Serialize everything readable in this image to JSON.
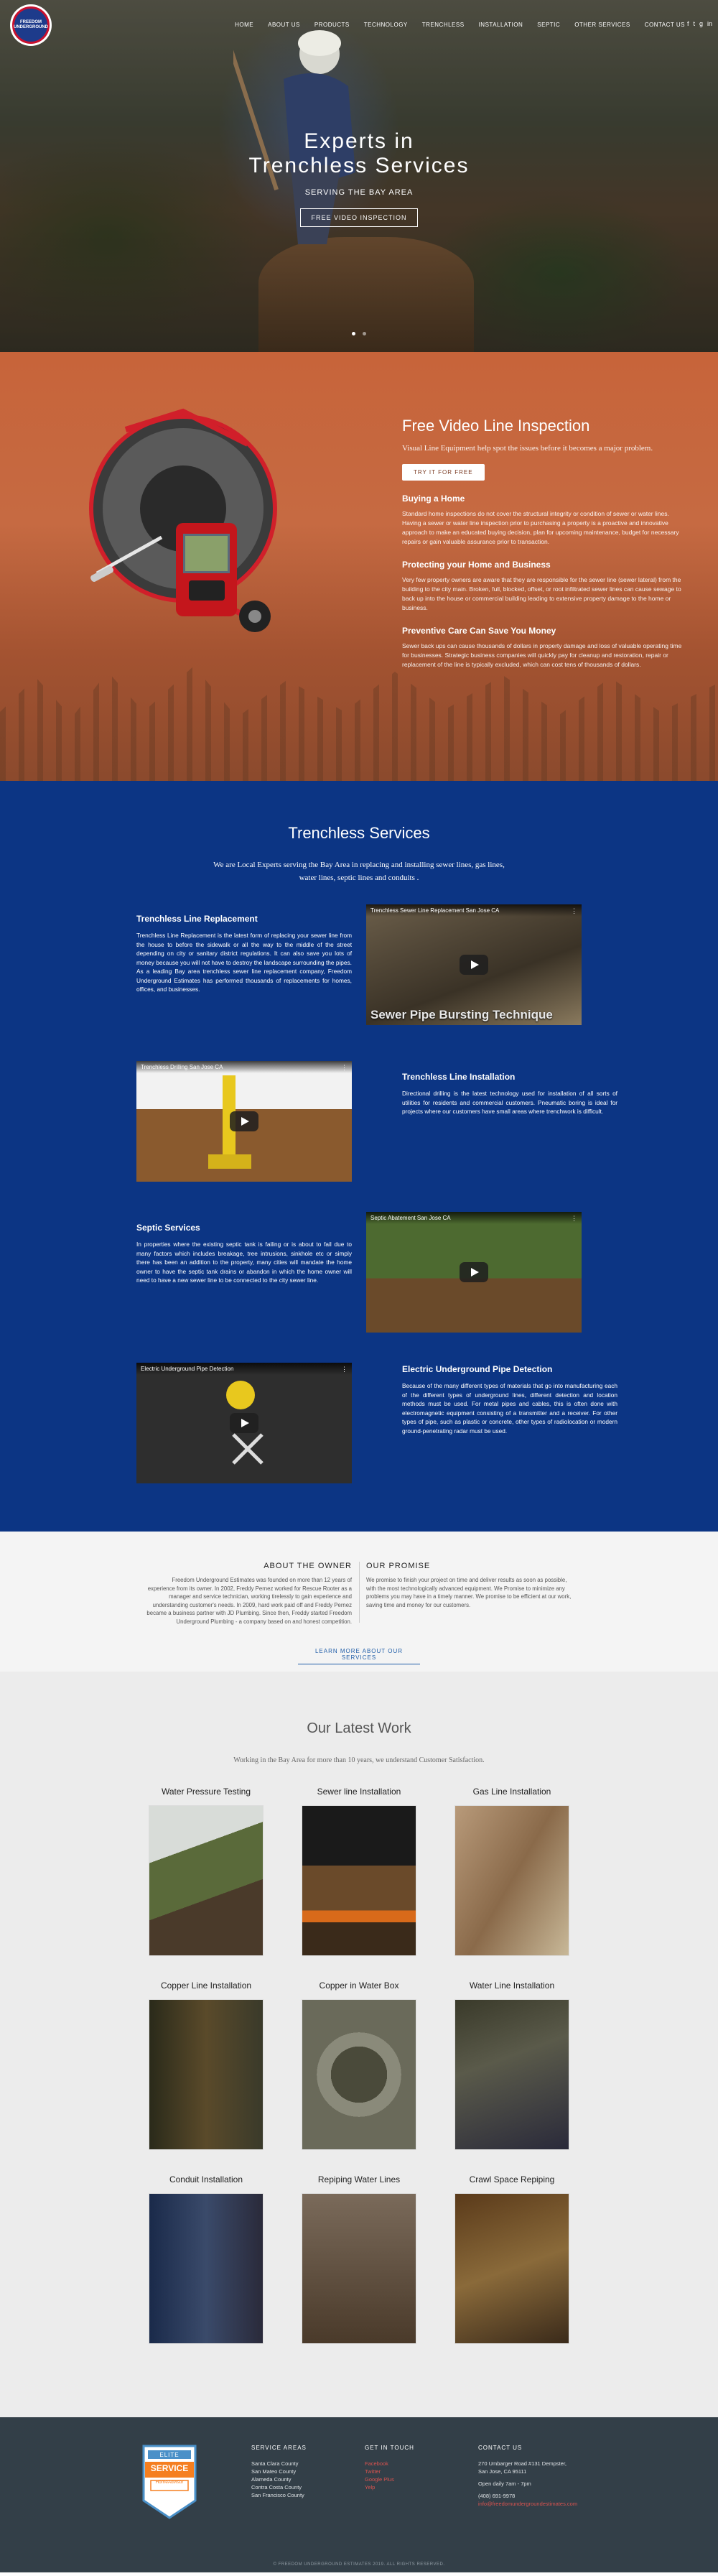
{
  "header": {
    "logo_text": "FREEDOM UNDERGROUND",
    "nav": [
      "HOME",
      "ABOUT US",
      "PRODUCTS",
      "TECHNOLOGY",
      "TRENCHLESS",
      "INSTALLATION",
      "SEPTIC",
      "OTHER SERVICES",
      "CONTACT US"
    ],
    "social": [
      "f",
      "t",
      "g",
      "in"
    ]
  },
  "hero": {
    "title": "Experts in Trenchless Services",
    "subtitle": "SERVING THE BAY AREA",
    "button": "FREE VIDEO INSPECTION"
  },
  "inspection": {
    "title": "Free Video Line Inspection",
    "lead": "Visual Line Equipment help spot the issues before it becomes a major problem.",
    "button": "TRY IT FOR FREE",
    "sections": [
      {
        "heading": "Buying a Home",
        "text": "Standard home inspections do not cover the structural integrity or condition of sewer or water lines. Having a sewer or water line inspection prior to purchasing a property is a proactive and innovative approach to make an educated buying decision, plan for upcoming maintenance, budget for necessary repairs or gain valuable assurance prior to transaction."
      },
      {
        "heading": "Protecting your Home and Business",
        "text": "Very few property owners are aware that they are responsible for the sewer line (sewer lateral) from the building to the city main. Broken, full, blocked, offset, or root infiltrated sewer lines can cause sewage to back up into the house or commercial building leading to extensive property damage to the home or business."
      },
      {
        "heading": "Preventive Care Can Save You Money",
        "text": "Sewer back ups can cause thousands of dollars in property damage and loss of valuable operating time for businesses. Strategic business companies will quickly pay for cleanup and restoration, repair or replacement of the line is typically excluded, which can cost tens of thousands of dollars."
      }
    ]
  },
  "trenchless": {
    "title": "Trenchless Services",
    "intro": "We are Local Experts serving the Bay Area in replacing and installing sewer lines, gas lines, water lines, septic lines and conduits .",
    "services": [
      {
        "heading": "Trenchless Line Replacement",
        "text": "Trenchless Line Replacement is the latest form of replacing your sewer line from the house to before the sidewalk or all the way to the middle of the street depending on city or sanitary district regulations. It can also save you lots of money because you will not have to destroy the landscape surrounding the pipes. As a leading Bay area trenchless sewer line replacement company, Freedom Underground Estimates has performed thousands of replacements for homes, offices, and businesses."
      },
      {
        "heading": "Trenchless Line Installation",
        "text": "Directional drilling is the latest technology used for installation of all sorts of utilities for residents and commercial customers. Pneumatic boring is ideal for projects where our customers have small areas where trenchwork is difficult."
      },
      {
        "heading": "Septic Services",
        "text": "In properties where the existing septic tank is failing or is about to fail due to many factors which includes breakage, tree intrusions, sinkhole etc or simply there has been an addition to the property, many cities will mandate the home owner to have the septic tank drains or abandon in which the home owner will need to have a new sewer line to be connected to the city sewer line."
      },
      {
        "heading": "Electric Underground Pipe Detection",
        "text": "Because of the many different types of materials that go into manufacturing each of the different types of underground lines, different detection and location methods must be used. For metal pipes and cables, this is often done with electromagnetic equipment consisting of a transmitter and a receiver. For other types of pipe, such as plastic or concrete, other types of radiolocation or modern ground-penetrating radar must be used."
      }
    ],
    "videos": [
      {
        "title": "Trenchless Sewer Line Replacement San Jose CA",
        "caption": "Sewer Pipe Bursting Technique"
      },
      {
        "title": "Trenchless Drilling San Jose CA",
        "caption": ""
      },
      {
        "title": "Septic Abatement San Jose CA",
        "caption": ""
      },
      {
        "title": "Electric Underground Pipe Detection",
        "caption": ""
      }
    ]
  },
  "about": {
    "owner_title": "ABOUT THE OWNER",
    "owner_text": "Freedom Underground Estimates was founded on more than 12 years of experience from its owner. In 2002, Freddy Pernez worked for Rescue Rooter as a manager and service technician, working tirelessly to gain experience and understanding customer's needs. In 2009, hard work paid off and Freddy Pernez became a business partner with JD Plumbing. Since then, Freddy started Freedom Underground Plumbing - a company based on and honest competition.",
    "promise_title": "OUR PROMISE",
    "promise_text": "We promise to finish your project on time and deliver results as soon as possible, with the most technologically advanced equipment. We Promise to minimize any problems you may have in a timely manner. We promise to be efficient at our work, saving time and money for our customers.",
    "button": "LEARN MORE ABOUT OUR SERVICES"
  },
  "work": {
    "title": "Our Latest Work",
    "intro": "Working in the Bay Area for more than 10 years, we understand Customer Satisfaction.",
    "items": [
      "Water Pressure Testing",
      "Sewer line Installation",
      "Gas Line Installation",
      "Copper Line Installation",
      "Copper in Water Box",
      "Water Line Installation",
      "Conduit Installation",
      "Repiping Water Lines",
      "Crawl Space Repiping"
    ]
  },
  "footer": {
    "badge_top": "ELITE",
    "badge_main": "SERVICE",
    "badge_brand": "HomeAdvisor",
    "service_areas_title": "SERVICE AREAS",
    "service_areas": [
      "Santa Clara County",
      "San Mateo County",
      "Alameda County",
      "Contra Costa County",
      "San Francisco County"
    ],
    "get_in_touch_title": "GET IN TOUCH",
    "get_in_touch": [
      "Facebook",
      "Twitter",
      "Google Plus",
      "Yelp"
    ],
    "contact_title": "CONTACT US",
    "contact": [
      "270 Umbarger Road #131 Dempster,",
      "San Jose, CA 95111",
      "",
      "Open daily 7am - 7pm",
      "",
      "(408) 691-9978",
      "info@freedomundergroundestimates.com"
    ],
    "copyright": "© FREEDOM UNDERGROUND ESTIMATES 2019. ALL RIGHTS RESERVED."
  },
  "colors": {
    "brand_blue": "#0c3584",
    "inspection_orange": "#c7643a",
    "footer_slate": "#333f48",
    "accent_red": "#d9534f"
  }
}
